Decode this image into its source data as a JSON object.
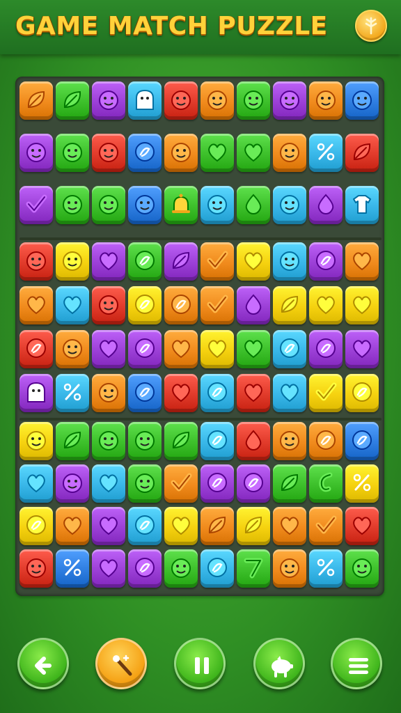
{
  "header": {
    "title": "GAME MATCH PUZZLE",
    "coin_icon": "coin-tree-icon"
  },
  "board": {
    "rows": 12,
    "cols": 10,
    "tiles": [
      [
        [
          "#f08a1c",
          "leaf"
        ],
        [
          "#3cbf2a",
          "leaf"
        ],
        [
          "#9b3fd6",
          "face"
        ],
        [
          "#38b6e8",
          "ghost"
        ],
        [
          "#e03a2a",
          "face"
        ],
        [
          "#f08a1c",
          "face"
        ],
        [
          "#3cbf2a",
          "face"
        ],
        [
          "#9b3fd6",
          "face"
        ],
        [
          "#f08a1c",
          "face"
        ],
        [
          "#2e7de0",
          "face"
        ]
      ],
      [
        [
          "#9b3fd6",
          "face"
        ],
        [
          "#3cbf2a",
          "face"
        ],
        [
          "#e03a2a",
          "face"
        ],
        [
          "#2e7de0",
          "swirl"
        ],
        [
          "#f08a1c",
          "face"
        ],
        [
          "#3cbf2a",
          "heart"
        ],
        [
          "#3cbf2a",
          "heart"
        ],
        [
          "#f08a1c",
          "face"
        ],
        [
          "#38b6e8",
          "percent"
        ],
        [
          "#e03a2a",
          "leaf"
        ]
      ],
      [
        [
          "#9b3fd6",
          "check"
        ],
        [
          "#3cbf2a",
          "face"
        ],
        [
          "#3cbf2a",
          "face"
        ],
        [
          "#2e7de0",
          "face"
        ],
        [
          "#3cbf2a",
          "bell"
        ],
        [
          "#38b6e8",
          "face"
        ],
        [
          "#3cbf2a",
          "drop"
        ],
        [
          "#38b6e8",
          "face"
        ],
        [
          "#9b3fd6",
          "drop"
        ],
        [
          "#38b6e8",
          "shirt"
        ]
      ],
      [
        [
          "#e03a2a",
          "face"
        ],
        [
          "#f5d10f",
          "face"
        ],
        [
          "#9b3fd6",
          "heart"
        ],
        [
          "#3cbf2a",
          "swirl"
        ],
        [
          "#9b3fd6",
          "leaf"
        ],
        [
          "#f08a1c",
          "check"
        ],
        [
          "#f5d10f",
          "heart"
        ],
        [
          "#38b6e8",
          "face"
        ],
        [
          "#9b3fd6",
          "swirl"
        ],
        [
          "#f08a1c",
          "heart"
        ]
      ],
      [
        [
          "#f08a1c",
          "heart"
        ],
        [
          "#38b6e8",
          "heart"
        ],
        [
          "#e03a2a",
          "face"
        ],
        [
          "#f5d10f",
          "swirl"
        ],
        [
          "#f08a1c",
          "swirl"
        ],
        [
          "#f08a1c",
          "check"
        ],
        [
          "#9b3fd6",
          "drop"
        ],
        [
          "#f5d10f",
          "leaf"
        ],
        [
          "#f5d10f",
          "heart"
        ],
        [
          "#f5d10f",
          "heart"
        ]
      ],
      [
        [
          "#e03a2a",
          "swirl"
        ],
        [
          "#f08a1c",
          "face"
        ],
        [
          "#9b3fd6",
          "heart"
        ],
        [
          "#9b3fd6",
          "swirl"
        ],
        [
          "#f08a1c",
          "heart"
        ],
        [
          "#f5d10f",
          "heart"
        ],
        [
          "#3cbf2a",
          "heart"
        ],
        [
          "#38b6e8",
          "swirl"
        ],
        [
          "#9b3fd6",
          "swirl"
        ],
        [
          "#9b3fd6",
          "heart"
        ]
      ],
      [
        [
          "#9b3fd6",
          "ghost"
        ],
        [
          "#38b6e8",
          "percent"
        ],
        [
          "#f08a1c",
          "face"
        ],
        [
          "#2e7de0",
          "swirl"
        ],
        [
          "#e03a2a",
          "heart"
        ],
        [
          "#38b6e8",
          "swirl"
        ],
        [
          "#e03a2a",
          "heart"
        ],
        [
          "#38b6e8",
          "heart"
        ],
        [
          "#f5d10f",
          "check"
        ],
        [
          "#f5d10f",
          "swirl"
        ]
      ],
      [
        [
          "#f5d10f",
          "face"
        ],
        [
          "#3cbf2a",
          "leaf"
        ],
        [
          "#3cbf2a",
          "face"
        ],
        [
          "#3cbf2a",
          "face"
        ],
        [
          "#3cbf2a",
          "leaf"
        ],
        [
          "#38b6e8",
          "swirl"
        ],
        [
          "#e03a2a",
          "drop"
        ],
        [
          "#f08a1c",
          "face"
        ],
        [
          "#f08a1c",
          "swirl"
        ],
        [
          "#2e7de0",
          "swirl"
        ]
      ],
      [
        [
          "#38b6e8",
          "heart"
        ],
        [
          "#9b3fd6",
          "face"
        ],
        [
          "#38b6e8",
          "heart"
        ],
        [
          "#3cbf2a",
          "face"
        ],
        [
          "#f08a1c",
          "check"
        ],
        [
          "#9b3fd6",
          "swirl"
        ],
        [
          "#9b3fd6",
          "swirl"
        ],
        [
          "#3cbf2a",
          "leaf"
        ],
        [
          "#3cbf2a",
          "hook"
        ],
        [
          "#f5d10f",
          "percent"
        ]
      ],
      [
        [
          "#f5d10f",
          "swirl"
        ],
        [
          "#f08a1c",
          "heart"
        ],
        [
          "#9b3fd6",
          "heart"
        ],
        [
          "#38b6e8",
          "swirl"
        ],
        [
          "#f5d10f",
          "heart"
        ],
        [
          "#f08a1c",
          "leaf"
        ],
        [
          "#f5d10f",
          "leaf"
        ],
        [
          "#f08a1c",
          "heart"
        ],
        [
          "#f08a1c",
          "check"
        ],
        [
          "#e03a2a",
          "heart"
        ]
      ],
      [
        [
          "#e03a2a",
          "face"
        ],
        [
          "#2e7de0",
          "percent"
        ],
        [
          "#9b3fd6",
          "heart"
        ],
        [
          "#9b3fd6",
          "swirl"
        ],
        [
          "#3cbf2a",
          "face"
        ],
        [
          "#38b6e8",
          "swirl"
        ],
        [
          "#3cbf2a",
          "seven"
        ],
        [
          "#f08a1c",
          "face"
        ],
        [
          "#38b6e8",
          "percent"
        ],
        [
          "#3cbf2a",
          "face"
        ]
      ]
    ]
  },
  "controls": {
    "buttons": [
      {
        "name": "back-button",
        "icon": "arrow-left-icon",
        "color": "green"
      },
      {
        "name": "hint-button",
        "icon": "magic-wand-icon",
        "color": "orange"
      },
      {
        "name": "pause-button",
        "icon": "pause-icon",
        "color": "green"
      },
      {
        "name": "shuffle-button",
        "icon": "piggy-icon",
        "color": "green"
      },
      {
        "name": "menu-button",
        "icon": "menu-icon",
        "color": "green"
      }
    ]
  }
}
